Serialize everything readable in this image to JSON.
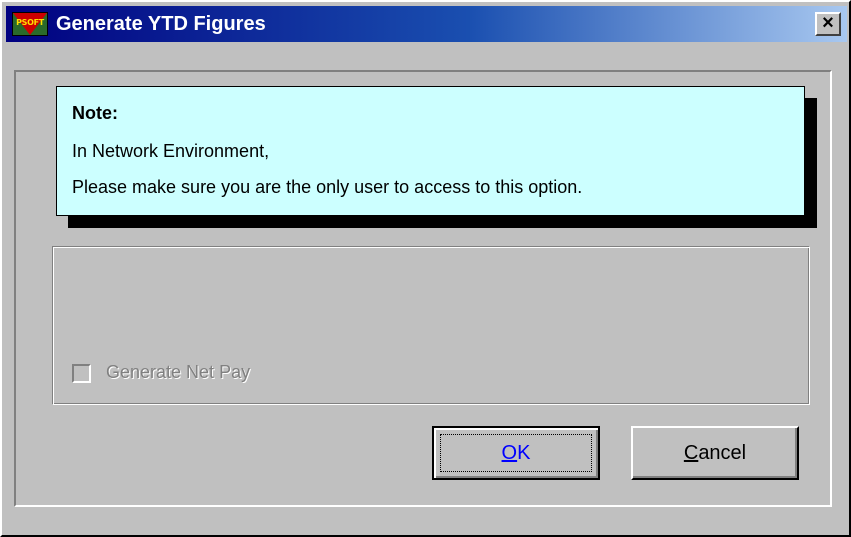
{
  "window": {
    "title": "Generate YTD Figures",
    "icon": "psoft-app-icon",
    "icon_text": "PSOFT",
    "close_label": "×"
  },
  "note": {
    "heading": "Note:",
    "line1": "In Network Environment,",
    "line2": "Please make sure you are the only user to access to this option.",
    "background_color": "#ccffff"
  },
  "options": {
    "generate_net_pay_label": "Generate Net Pay",
    "generate_net_pay_checked": false,
    "generate_net_pay_enabled": false
  },
  "buttons": {
    "ok_label": "OK",
    "ok_mnemonic": "O",
    "cancel_label": "Cancel",
    "cancel_mnemonic": "C"
  },
  "colors": {
    "titlebar_start": "#000080",
    "titlebar_end": "#a8c8f0",
    "dialog_face": "#c0c0c0"
  }
}
